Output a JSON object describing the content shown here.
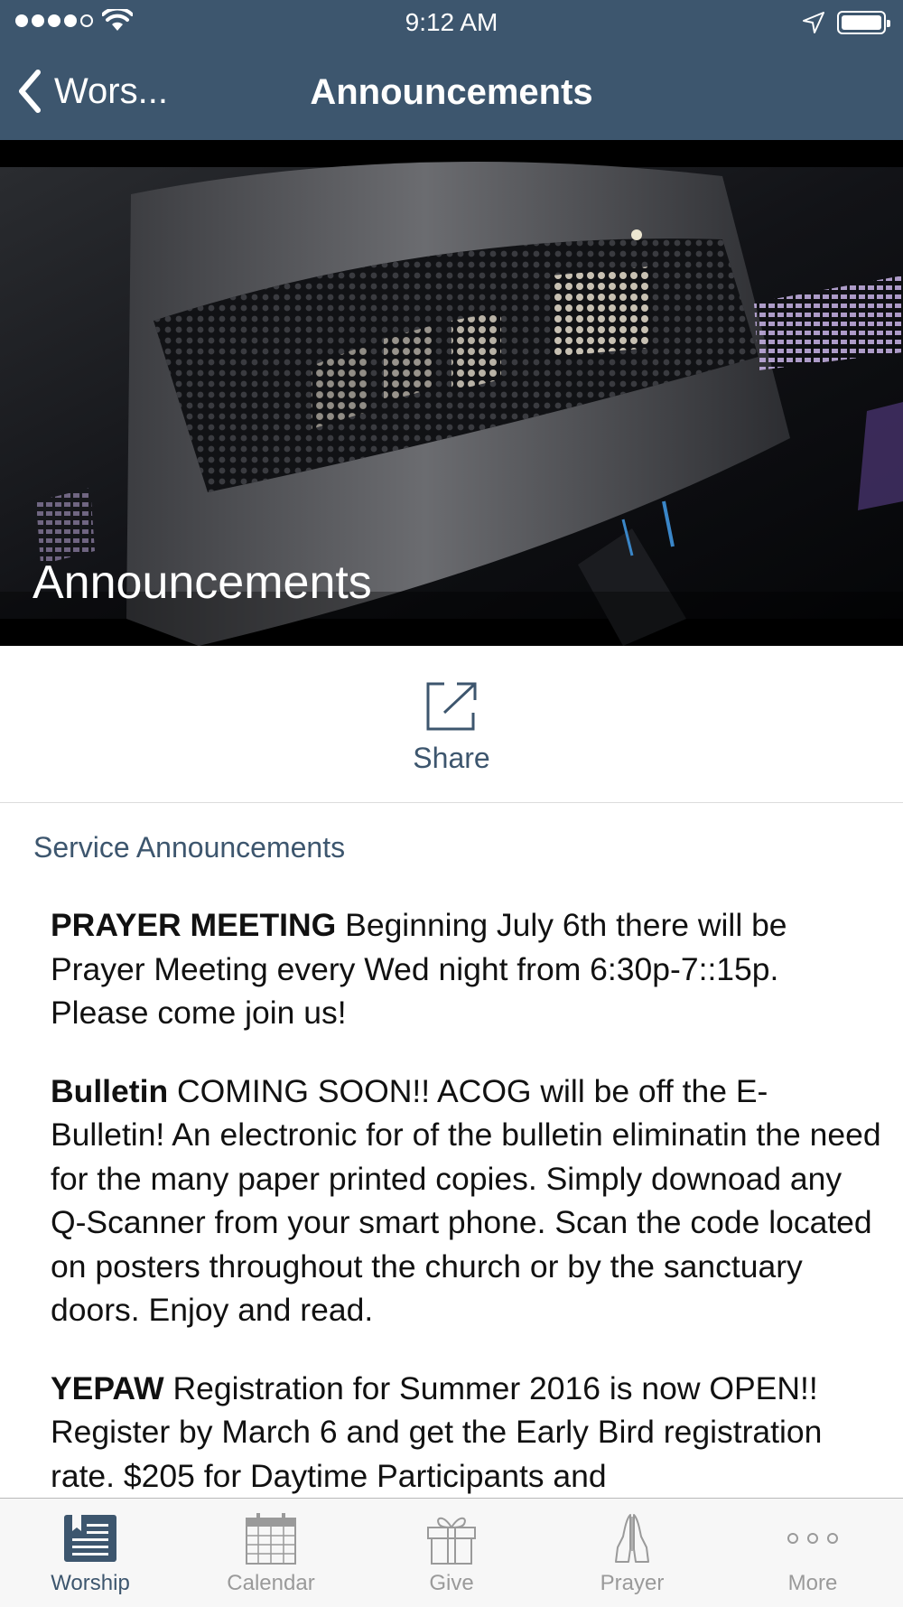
{
  "status_bar": {
    "time": "9:12 AM"
  },
  "nav": {
    "back_label": "Wors...",
    "title": "Announcements"
  },
  "hero": {
    "title": "Announcements"
  },
  "share": {
    "label": "Share"
  },
  "section": {
    "title": "Service Announcements"
  },
  "announcements": [
    {
      "heading": "PRAYER MEETING",
      "text": " Beginning July 6th there will be Prayer Meeting every Wed night from 6:30p-7::15p. Please come join us!"
    },
    {
      "heading": "Bulletin",
      "text": " COMING SOON!! ACOG will be off the E-Bulletin! An electronic for of the bulletin eliminatin the need for the many paper printed copies. Simply downoad any Q-Scanner from your smart phone. Scan the code located on posters throughout the church or by the sanctuary doors. Enjoy and read."
    },
    {
      "heading": "YEPAW",
      "text": " Registration for Summer 2016 is now OPEN!! Register by March 6 and get the Early Bird registration rate. $205 for Daytime Participants and"
    }
  ],
  "tabbar": {
    "tabs": [
      {
        "label": "Worship",
        "icon": "worship-icon",
        "active": true
      },
      {
        "label": "Calendar",
        "icon": "calendar-icon",
        "active": false
      },
      {
        "label": "Give",
        "icon": "gift-icon",
        "active": false
      },
      {
        "label": "Prayer",
        "icon": "praying-hands-icon",
        "active": false
      },
      {
        "label": "More",
        "icon": "more-icon",
        "active": false
      }
    ]
  },
  "colors": {
    "header_bg": "#3d566e",
    "accent": "#3d566e",
    "tab_inactive": "#9a9a9a"
  }
}
